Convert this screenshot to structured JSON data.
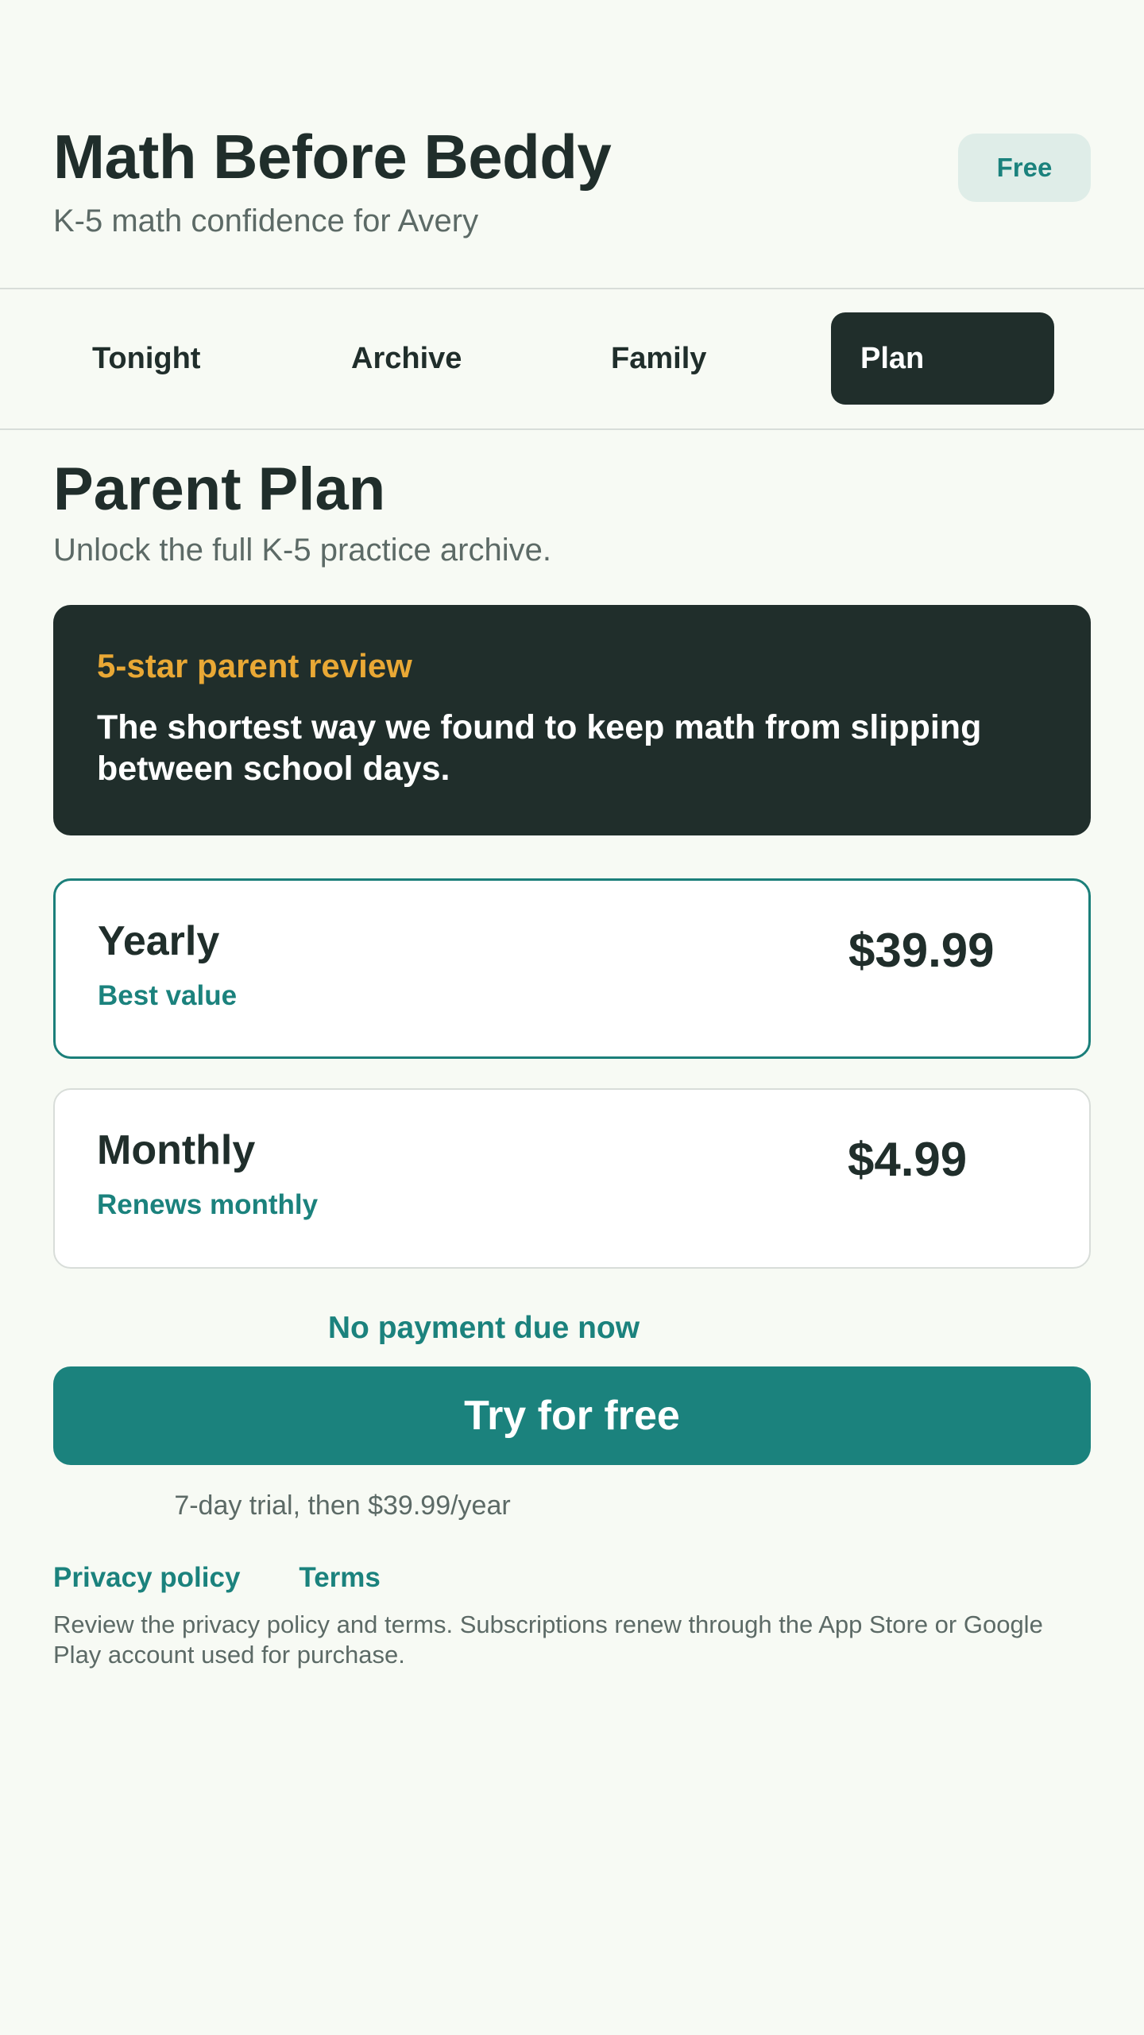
{
  "header": {
    "title": "Math Before Beddy",
    "subtitle": "K-5 math confidence for Avery",
    "badge": "Free"
  },
  "tabs": [
    {
      "label": "Tonight",
      "active": false
    },
    {
      "label": "Archive",
      "active": false
    },
    {
      "label": "Family",
      "active": false
    },
    {
      "label": "Plan",
      "active": true
    }
  ],
  "page": {
    "title": "Parent Plan",
    "subtitle": "Unlock the full K-5 practice archive."
  },
  "review": {
    "label": "5-star parent review",
    "quote": "The shortest way we found to keep math from slipping between school days."
  },
  "plans": [
    {
      "name": "Yearly",
      "note": "Best value",
      "price": "$39.99",
      "selected": true
    },
    {
      "name": "Monthly",
      "note": "Renews monthly",
      "price": "$4.99",
      "selected": false
    }
  ],
  "cta": {
    "notice": "No payment due now",
    "button": "Try for free",
    "trial_note": "7-day trial, then $39.99/year"
  },
  "footer": {
    "privacy_link": "Privacy policy",
    "terms_link": "Terms",
    "legal": "Review the privacy policy and terms. Subscriptions renew through the App Store or Google Play account used for purchase."
  },
  "colors": {
    "background": "#f7faf4",
    "ink": "#202e2b",
    "accent": "#1b827d",
    "review_highlight": "#e9a835",
    "badge_bg": "#dfede8"
  }
}
